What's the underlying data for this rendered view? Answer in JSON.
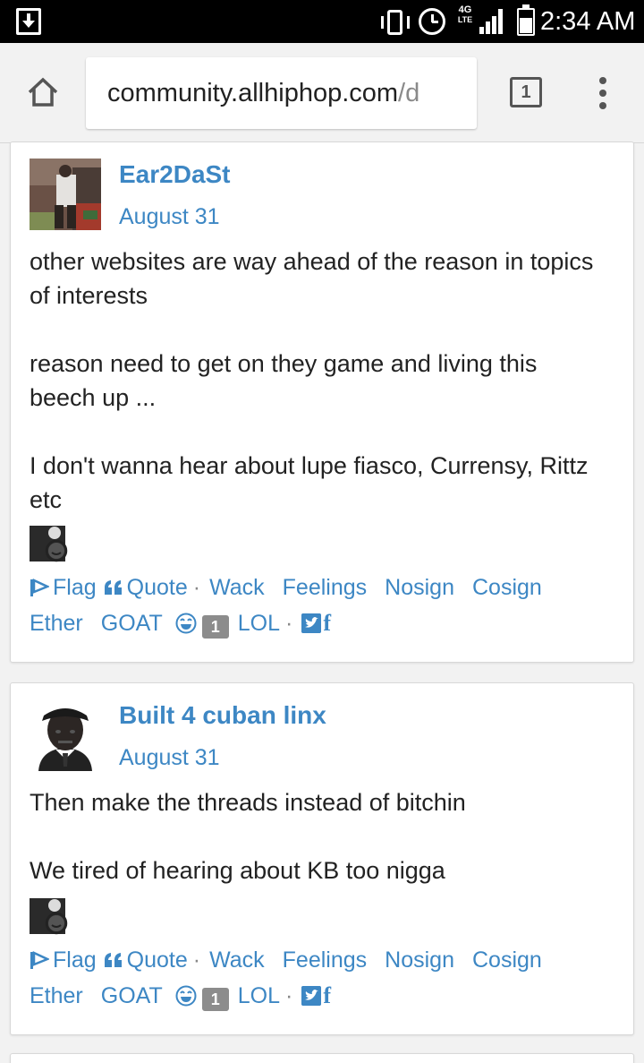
{
  "status_bar": {
    "time": "2:34 AM",
    "network": "4G",
    "network_sub": "LTE"
  },
  "browser": {
    "url_host": "community.allhiphop.com",
    "url_path": "/d",
    "tab_count": "1"
  },
  "colors": {
    "link": "#3d87c4",
    "badge": "#8c8c8c"
  },
  "reaction_labels": {
    "flag": "Flag",
    "quote": "Quote",
    "separator": "·",
    "wack": "Wack",
    "feelings": "Feelings",
    "nosign": "Nosign",
    "cosign": "Cosign",
    "ether": "Ether",
    "goat": "GOAT",
    "lol": "LOL",
    "facebook": "f"
  },
  "posts": [
    {
      "author": "Ear2DaSt",
      "date": "August 31",
      "paragraphs": [
        "other websites are way ahead of the reason in topics of interests",
        "reason need to get on they game and living this beech up ...",
        "I don't wanna hear about lupe fiasco, Currensy, Rittz etc"
      ],
      "lol_count": "1"
    },
    {
      "author": "Built 4 cuban linx",
      "date": "August 31",
      "paragraphs": [
        "Then make the threads instead of bitchin",
        "We tired of hearing about KB too nigga"
      ],
      "lol_count": "1"
    }
  ]
}
